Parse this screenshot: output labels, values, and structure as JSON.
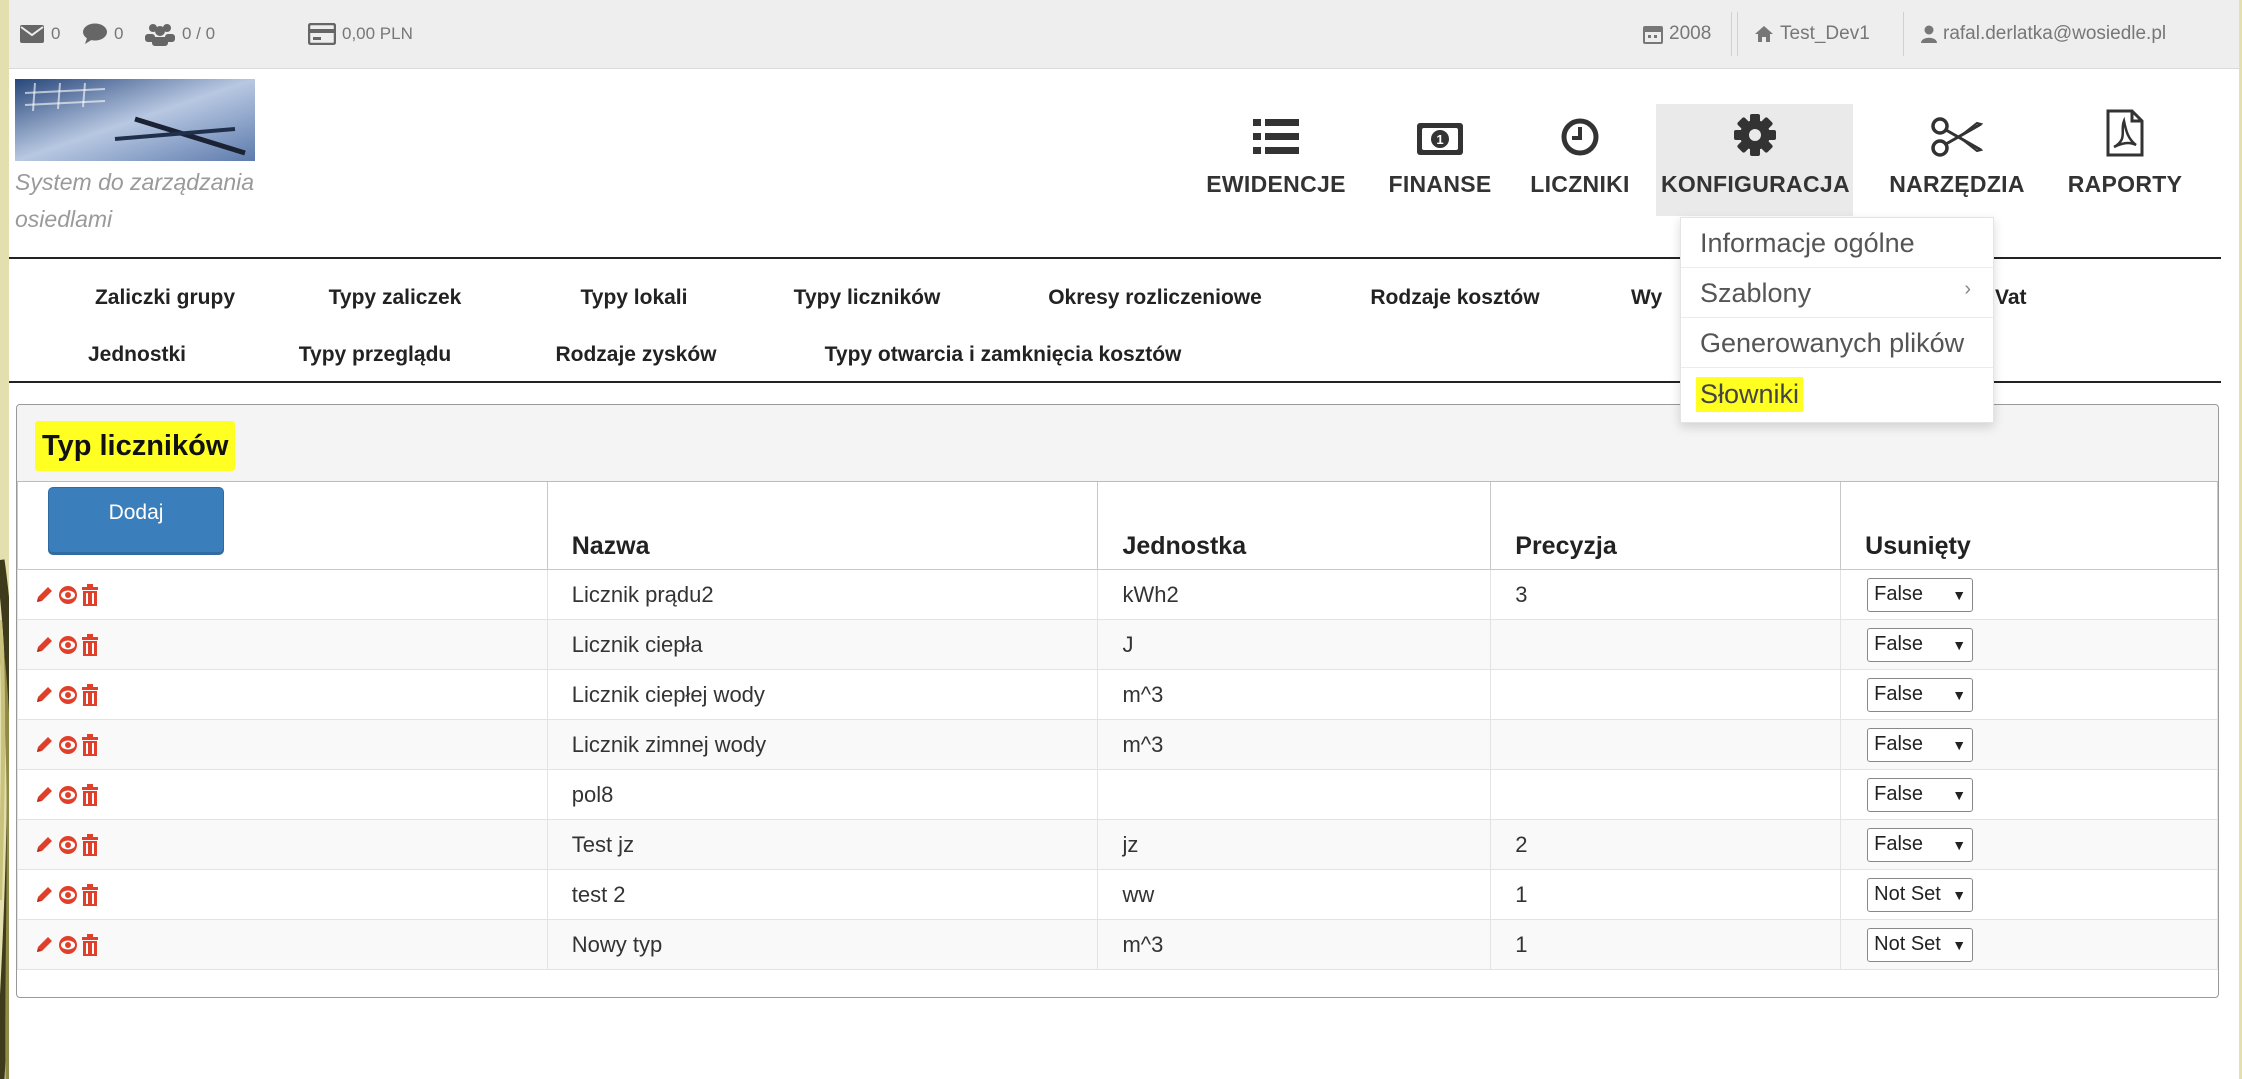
{
  "topbar": {
    "mail_count": "0",
    "chat_count": "0",
    "users_count": "0 / 0",
    "balance": "0,00 PLN",
    "year": "2008",
    "estate": "Test_Dev1",
    "user_email": "rafal.derlatka@wosiedle.pl"
  },
  "header": {
    "tagline": "System do zarządzania osiedlami",
    "nav": [
      {
        "label": "EWIDENCJE",
        "icon": "list-icon"
      },
      {
        "label": "FINANSE",
        "icon": "money-icon"
      },
      {
        "label": "LICZNIKI",
        "icon": "clock-icon"
      },
      {
        "label": "KONFIGURACJA",
        "icon": "gear-icon"
      },
      {
        "label": "NARZĘDZIA",
        "icon": "scissors-icon"
      },
      {
        "label": "RAPORTY",
        "icon": "pdf-file-icon"
      }
    ]
  },
  "tabs_row1": [
    "Zaliczki grupy",
    "Typy zaliczek",
    "Typy lokali",
    "Typy liczników",
    "Okresy rozliczeniowe",
    "Rodzaje kosztów",
    "Wy",
    "Vat"
  ],
  "tabs_row2": [
    "Jednostki",
    "Typy przeglądu",
    "Rodzaje zysków",
    "Typy otwarcia i zamknięcia kosztów"
  ],
  "dropdown": {
    "items": [
      "Informacje ogólne",
      "Szablony",
      "Generowanych plików",
      "Słowniki"
    ]
  },
  "panel": {
    "title": "Typ liczników",
    "add_button": "Dodaj",
    "columns": [
      "Nazwa",
      "Jednostka",
      "Precyzja",
      "Usunięty"
    ],
    "rows": [
      {
        "name": "Licznik prądu2",
        "unit": "kWh2",
        "precision": "3",
        "deleted": "False"
      },
      {
        "name": "Licznik ciepła",
        "unit": "J",
        "precision": "",
        "deleted": "False"
      },
      {
        "name": "Licznik ciepłej wody",
        "unit": "m^3",
        "precision": "",
        "deleted": "False"
      },
      {
        "name": "Licznik zimnej wody",
        "unit": "m^3",
        "precision": "",
        "deleted": "False"
      },
      {
        "name": "pol8",
        "unit": "",
        "precision": "",
        "deleted": "False"
      },
      {
        "name": "Test jz",
        "unit": "jz",
        "precision": "2",
        "deleted": "False"
      },
      {
        "name": "test 2",
        "unit": "ww",
        "precision": "1",
        "deleted": "Not Set"
      },
      {
        "name": "Nowy typ",
        "unit": "m^3",
        "precision": "1",
        "deleted": "Not Set"
      }
    ]
  },
  "colors": {
    "accent_blue": "#3b7ebc",
    "highlight": "#ffff22",
    "action_red": "#e0402a"
  }
}
